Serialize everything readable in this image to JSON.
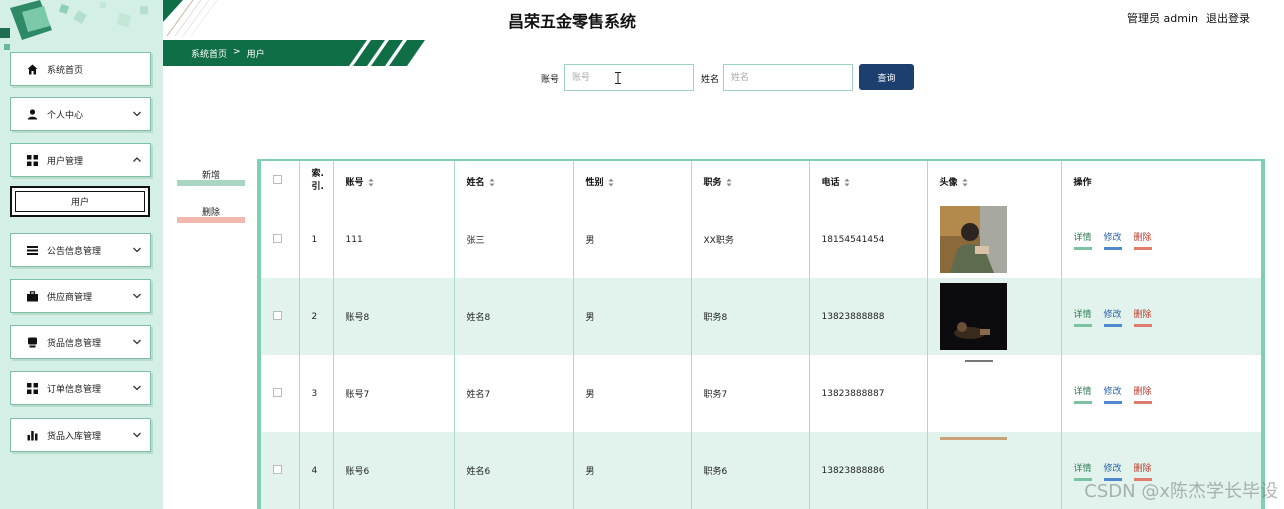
{
  "header": {
    "app_title": "昌荣五金零售系统",
    "role_label": "管理员 admin",
    "logout_label": "退出登录"
  },
  "sidebar": {
    "items": [
      {
        "label": "系统首页",
        "icon": "home-icon"
      },
      {
        "label": "个人中心",
        "icon": "user-icon"
      },
      {
        "label": "用户管理",
        "icon": "grid-icon"
      },
      {
        "label": "公告信息管理",
        "icon": "list-icon"
      },
      {
        "label": "供应商管理",
        "icon": "briefcase-icon"
      },
      {
        "label": "货品信息管理",
        "icon": "box-icon"
      },
      {
        "label": "订单信息管理",
        "icon": "grid-icon"
      },
      {
        "label": "货品入库管理",
        "icon": "bar-chart-icon"
      }
    ],
    "sub_item": "用户"
  },
  "breadcrumb": {
    "home": "系统首页",
    "separator": ">",
    "current": "用户"
  },
  "search": {
    "account_label": "账号",
    "account_placeholder": "账号",
    "name_label": "姓名",
    "name_placeholder": "姓名",
    "query_button": "查询"
  },
  "actions": {
    "add": "新增",
    "delete": "删除"
  },
  "table": {
    "columns": [
      "索引",
      "账号",
      "姓名",
      "性别",
      "职务",
      "电话",
      "头像",
      "操作"
    ],
    "index_header_line1": "索.",
    "index_header_line2": "引.",
    "rows": [
      {
        "index": "1",
        "account": "111",
        "name": "张三",
        "gender": "男",
        "position": "XX职务",
        "phone": "18154541454"
      },
      {
        "index": "2",
        "account": "账号8",
        "name": "姓名8",
        "gender": "男",
        "position": "职务8",
        "phone": "13823888888"
      },
      {
        "index": "3",
        "account": "账号7",
        "name": "姓名7",
        "gender": "男",
        "position": "职务7",
        "phone": "13823888887"
      },
      {
        "index": "4",
        "account": "账号6",
        "name": "姓名6",
        "gender": "男",
        "position": "职务6",
        "phone": "13823888886"
      }
    ],
    "ops": {
      "detail": "详情",
      "edit": "修改",
      "delete": "删除"
    }
  },
  "watermark": "CSDN @x陈杰学长毕设",
  "colors": {
    "sidebar_bg": "#d4efe6",
    "accent_green": "#0f6e45",
    "query_button": "#1d3f70",
    "row_alt": "#e1f3ec"
  }
}
